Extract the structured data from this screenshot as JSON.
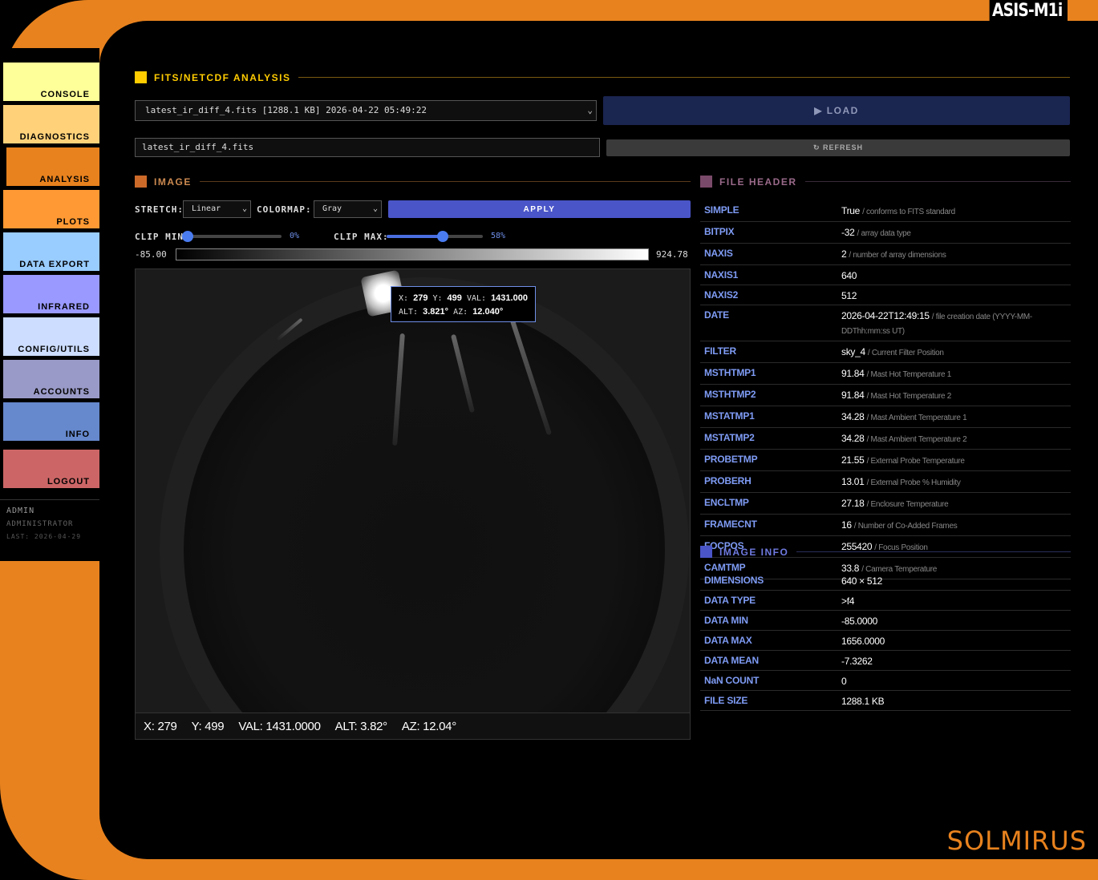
{
  "app": {
    "brand": "ASIS-M1i",
    "logo": "SOLMIRUS"
  },
  "nav": [
    {
      "label": "CONSOLE",
      "color": "#ffff99"
    },
    {
      "label": "DIAGNOSTICS",
      "color": "#ffd27a"
    },
    {
      "label": "ANALYSIS",
      "color": "#e8821e"
    },
    {
      "label": "PLOTS",
      "color": "#ff9933"
    },
    {
      "label": "DATA EXPORT",
      "color": "#99ccff"
    },
    {
      "label": "INFRARED",
      "color": "#9999ff"
    },
    {
      "label": "CONFIG/UTILS",
      "color": "#ccddff"
    },
    {
      "label": "ACCOUNTS",
      "color": "#9a9ac8"
    },
    {
      "label": "INFO",
      "color": "#6688cc"
    },
    {
      "label": "LOGOUT",
      "color": "#cc6666"
    }
  ],
  "user": {
    "name": "ADMIN",
    "role": "ADMINISTRATOR",
    "last": "LAST: 2026-04-29"
  },
  "analysis": {
    "title": "FITS/NETCDF ANALYSIS",
    "file_select": "latest_ir_diff_4.fits [1288.1 KB] 2026-04-22 05:49:22",
    "load_label": "▶ LOAD",
    "file_input": "latest_ir_diff_4.fits",
    "refresh_label": "↻ REFRESH"
  },
  "image": {
    "title": "IMAGE",
    "stretch_label": "STRETCH:",
    "stretch_value": "Linear",
    "colormap_label": "COLORMAP:",
    "colormap_value": "Gray",
    "apply_label": "APPLY",
    "clip_min_label": "CLIP MIN:",
    "clip_min_pct": 0,
    "clip_min_text": "0%",
    "clip_max_label": "CLIP MAX:",
    "clip_max_pct": 58,
    "clip_max_text": "58%",
    "range_min": "-85.00",
    "range_max": "924.78",
    "tooltip": {
      "x_label": "X:",
      "x": "279",
      "y_label": "Y:",
      "y": "499",
      "val_label": "VAL:",
      "val": "1431.000",
      "alt_label": "ALT:",
      "alt": "3.821°",
      "az_label": "AZ:",
      "az": "12.040°"
    },
    "coords": {
      "x": "X: 279",
      "y": "Y: 499",
      "val": "VAL: 1431.0000",
      "alt": "ALT: 3.82°",
      "az": "AZ: 12.04°"
    }
  },
  "file_header": {
    "title": "FILE HEADER",
    "rows": [
      {
        "key": "SIMPLE",
        "value": "True",
        "comment": "/ conforms to FITS standard"
      },
      {
        "key": "BITPIX",
        "value": "-32",
        "comment": "/ array data type"
      },
      {
        "key": "NAXIS",
        "value": "2",
        "comment": "/ number of array dimensions"
      },
      {
        "key": "NAXIS1",
        "value": "640",
        "comment": ""
      },
      {
        "key": "NAXIS2",
        "value": "512",
        "comment": ""
      },
      {
        "key": "DATE",
        "value": "2026-04-22T12:49:15",
        "comment": "/ file creation date (YYYY-MM-DDThh:mm:ss UT)"
      },
      {
        "key": "FILTER",
        "value": "sky_4",
        "comment": "/ Current Filter Position"
      },
      {
        "key": "MSTHTMP1",
        "value": "91.84",
        "comment": "/ Mast Hot Temperature 1"
      },
      {
        "key": "MSTHTMP2",
        "value": "91.84",
        "comment": "/ Mast Hot Temperature 2"
      },
      {
        "key": "MSTATMP1",
        "value": "34.28",
        "comment": "/ Mast Ambient Temperature 1"
      },
      {
        "key": "MSTATMP2",
        "value": "34.28",
        "comment": "/ Mast Ambient Temperature 2"
      },
      {
        "key": "PROBETMP",
        "value": "21.55",
        "comment": "/ External Probe Temperature"
      },
      {
        "key": "PROBERH",
        "value": "13.01",
        "comment": "/ External Probe % Humidity"
      },
      {
        "key": "ENCLTMP",
        "value": "27.18",
        "comment": "/ Enclosure Temperature"
      },
      {
        "key": "FRAMECNT",
        "value": "16",
        "comment": "/ Number of Co-Added Frames"
      },
      {
        "key": "FOCPOS",
        "value": "255420",
        "comment": "/ Focus Position"
      },
      {
        "key": "CAMTMP",
        "value": "33.8",
        "comment": "/ Camera Temperature"
      }
    ]
  },
  "image_info": {
    "title": "IMAGE INFO",
    "rows": [
      {
        "key": "DIMENSIONS",
        "value": "640 × 512"
      },
      {
        "key": "DATA TYPE",
        "value": ">f4"
      },
      {
        "key": "DATA MIN",
        "value": "-85.0000"
      },
      {
        "key": "DATA MAX",
        "value": "1656.0000"
      },
      {
        "key": "DATA MEAN",
        "value": "-7.3262"
      },
      {
        "key": "NaN COUNT",
        "value": "0"
      },
      {
        "key": "FILE SIZE",
        "value": "1288.1 KB"
      }
    ]
  },
  "colors": {
    "frame": "#e8821e",
    "analysis_sq": "#ffcc00",
    "image_sq": "#cc6a2a",
    "header_sq": "#7a4a6a",
    "info_sq": "#4a55c8",
    "key_blue": "#7f9cf5"
  }
}
